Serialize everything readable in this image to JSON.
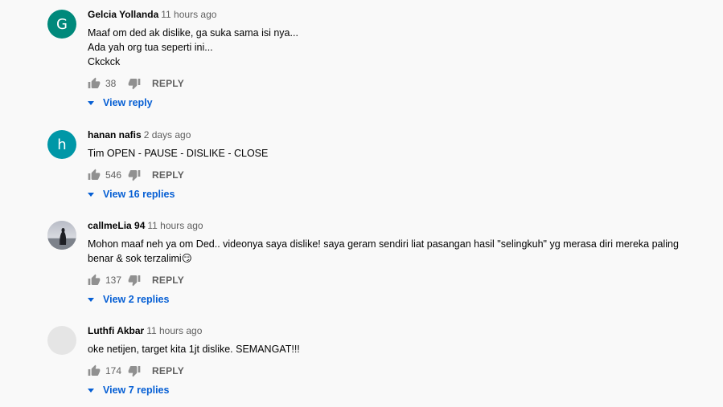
{
  "comments": [
    {
      "author": "Gelcia Yollanda",
      "time": "11 hours ago",
      "avatar_letter": "G",
      "avatar_color": "#00897b",
      "avatar_type": "letter",
      "lines": [
        "Maaf om ded ak dislike, ga suka sama isi nya...",
        "Ada yah org tua seperti ini...",
        "Ckckck"
      ],
      "likes": "38",
      "reply_label": "REPLY",
      "view_replies": "View reply"
    },
    {
      "author": "hanan nafis",
      "time": "2 days ago",
      "avatar_letter": "h",
      "avatar_color": "#0097a7",
      "avatar_type": "letter",
      "lines": [
        "Tim OPEN - PAUSE - DISLIKE - CLOSE"
      ],
      "likes": "546",
      "reply_label": "REPLY",
      "view_replies": "View 16 replies"
    },
    {
      "author": "callmeLia 94",
      "time": "11 hours ago",
      "avatar_letter": "",
      "avatar_color": "#c9ccd2",
      "avatar_type": "photo",
      "lines": [
        "Mohon maaf neh ya om Ded.. videonya saya dislike! saya geram sendiri liat pasangan hasil \"selingkuh\" yg merasa diri mereka paling",
        "benar & sok terzalimi😏"
      ],
      "likes": "137",
      "reply_label": "REPLY",
      "view_replies": "View 2 replies"
    },
    {
      "author": "Luthfi Akbar",
      "time": "11 hours ago",
      "avatar_letter": "",
      "avatar_color": "#e5e5e5",
      "avatar_type": "blank",
      "lines": [
        "oke netijen, target kita 1jt dislike. SEMANGAT!!!"
      ],
      "likes": "174",
      "reply_label": "REPLY",
      "view_replies": "View 7 replies"
    }
  ]
}
